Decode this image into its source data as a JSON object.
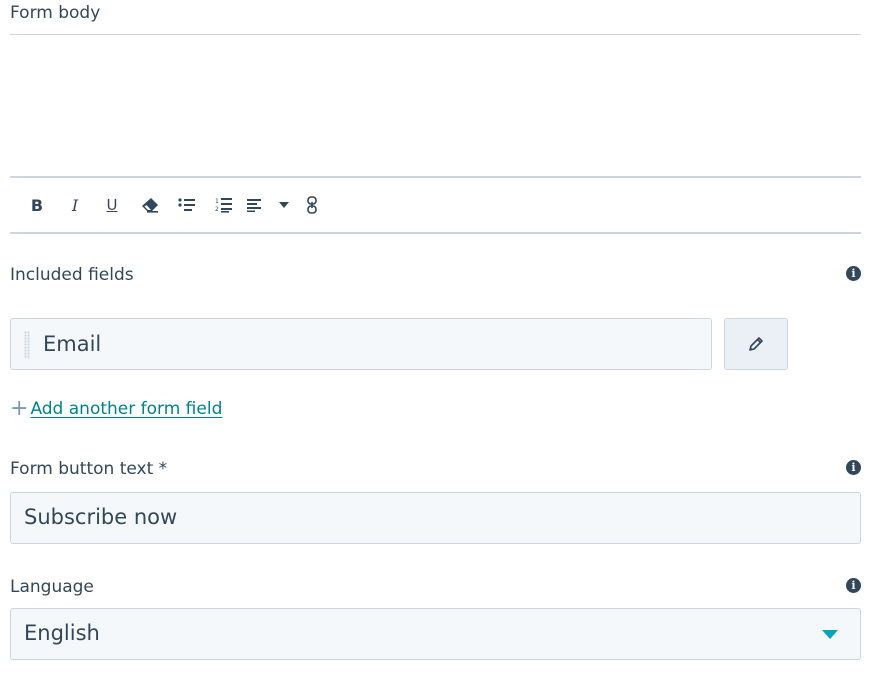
{
  "form_body": {
    "label": "Form body"
  },
  "toolbar": {
    "icons": [
      "bold-icon",
      "italic-icon",
      "underline-icon",
      "clear-format-icon",
      "bulleted-list-icon",
      "numbered-list-icon",
      "align-icon",
      "dropdown-caret-icon",
      "link-icon"
    ]
  },
  "included_fields": {
    "label": "Included fields",
    "items": [
      "Email"
    ]
  },
  "add_field": {
    "plus": "+",
    "label": "Add another form field"
  },
  "button_text": {
    "label": "Form button text *",
    "value": "Subscribe now"
  },
  "language": {
    "label": "Language",
    "value": "English"
  },
  "colors": {
    "text": "#33475b",
    "border": "#cbd6e2",
    "input_bg": "#f5f8fa",
    "link": "#00838f",
    "accent": "#00a4bd"
  }
}
